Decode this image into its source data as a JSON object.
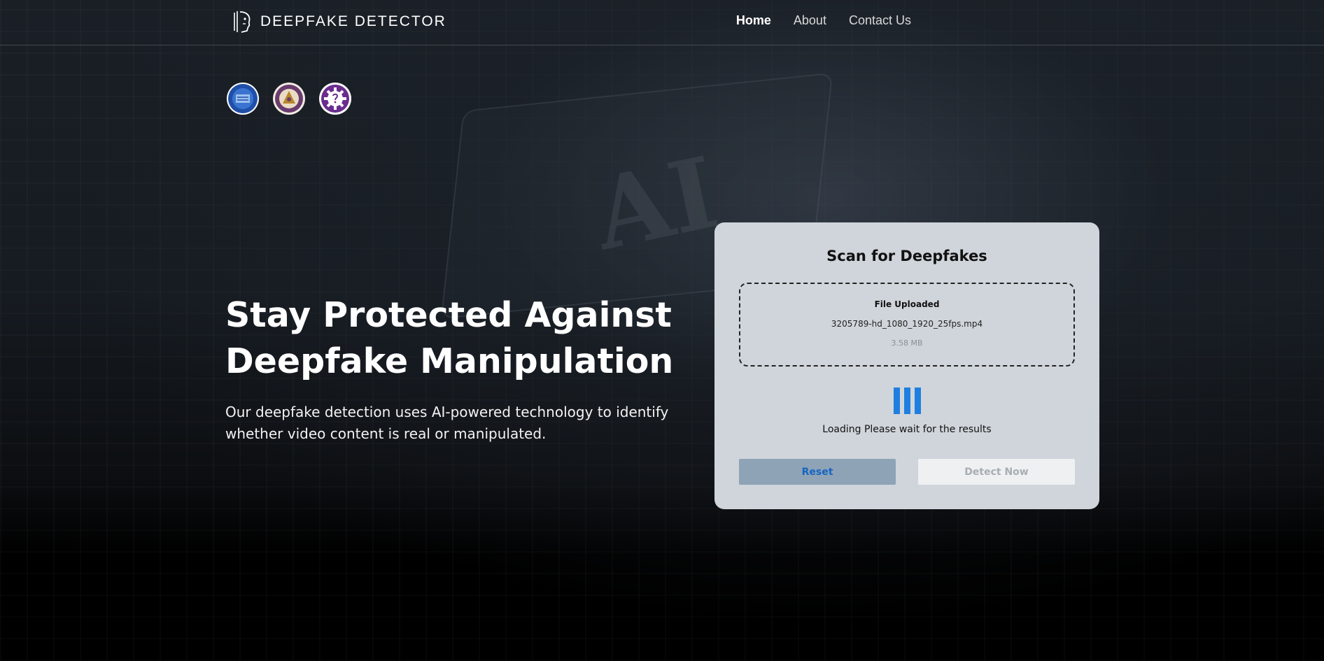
{
  "header": {
    "brand": "DEEPFAKE DETECTOR",
    "nav": [
      {
        "label": "Home",
        "active": true
      },
      {
        "label": "About",
        "active": false
      },
      {
        "label": "Contact Us",
        "active": false
      }
    ]
  },
  "seals": [
    "seal-blue-icon",
    "seal-gold-icon",
    "seal-purple-gear-icon"
  ],
  "hero": {
    "title_line1": "Stay Protected Against",
    "title_line2": "Deepfake Manipulation",
    "description": "Our deepfake detection uses AI-powered technology to identify whether video content is real or manipulated."
  },
  "scan": {
    "title": "Scan for Deepfakes",
    "upload_status": "File Uploaded",
    "file_name": "3205789-hd_1080_1920_25fps.mp4",
    "file_size": "3.58 MB",
    "loading_text": "Loading Please wait for the results",
    "reset_label": "Reset",
    "detect_label": "Detect Now"
  },
  "colors": {
    "accent": "#1e7fe0",
    "card_bg": "#d0d5db",
    "reset_bg": "#8ea3b6",
    "detect_bg": "#eef0f2"
  }
}
